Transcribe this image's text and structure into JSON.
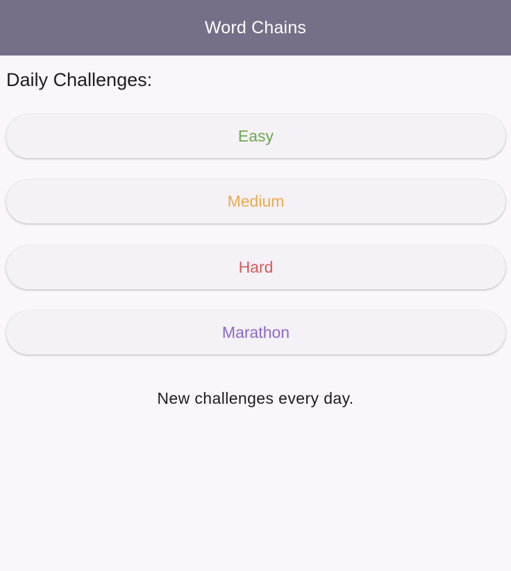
{
  "app_bar": {
    "title": "Word Chains",
    "background": "#776e87"
  },
  "main": {
    "heading": "Daily Challenges:",
    "challenges": [
      {
        "label": "Easy",
        "color": "#6aa84f"
      },
      {
        "label": "Medium",
        "color": "#e9ab4b"
      },
      {
        "label": "Hard",
        "color": "#d55a5a"
      },
      {
        "label": "Marathon",
        "color": "#8c68c6"
      }
    ],
    "footer_note": "New challenges every day."
  }
}
